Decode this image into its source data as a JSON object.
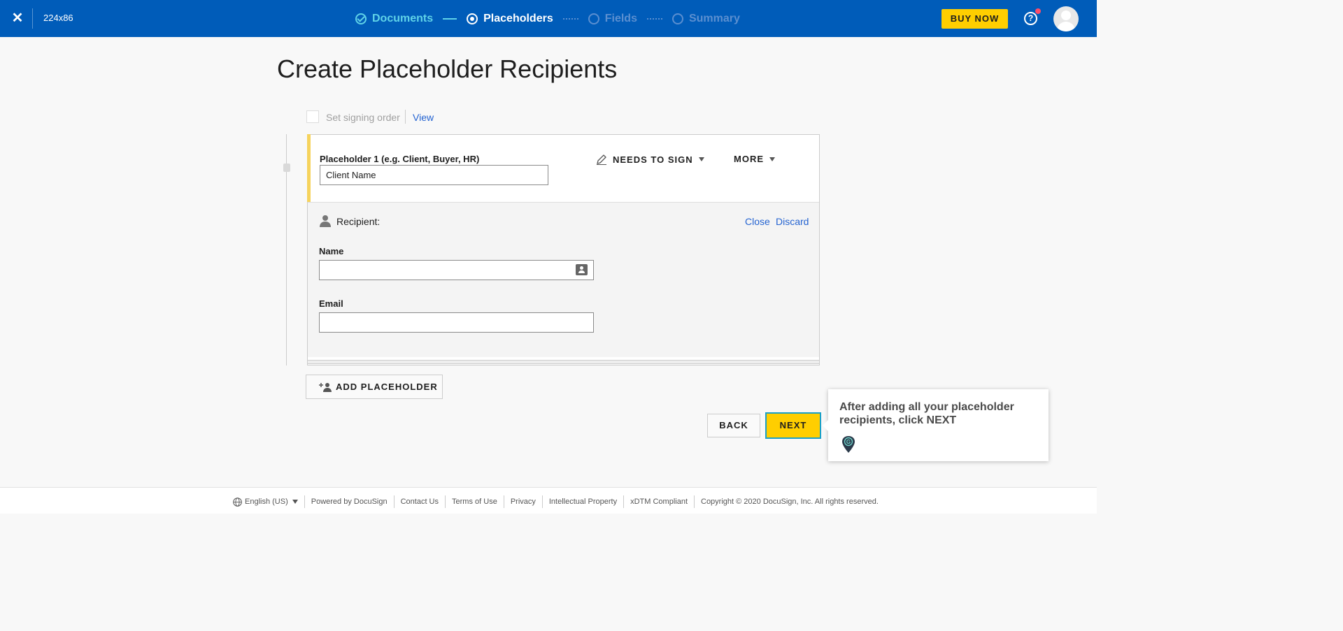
{
  "header": {
    "close_glyph": "✕",
    "document_title": "224x86",
    "steps": [
      {
        "label": "Documents",
        "state": "done"
      },
      {
        "label": "Placeholders",
        "state": "active"
      },
      {
        "label": "Fields",
        "state": "future"
      },
      {
        "label": "Summary",
        "state": "future"
      }
    ],
    "buy_now_label": "BUY NOW",
    "help_glyph": "?"
  },
  "page": {
    "title": "Create Placeholder Recipients",
    "signing_order_label": "Set signing order",
    "view_link": "View"
  },
  "placeholder": {
    "label": "Placeholder 1 (e.g. Client, Buyer, HR)",
    "value": "Client Name",
    "action_label": "NEEDS TO SIGN",
    "more_label": "MORE",
    "recipient": {
      "heading": "Recipient:",
      "close_label": "Close",
      "discard_label": "Discard",
      "name_label": "Name",
      "name_value": "",
      "email_label": "Email",
      "email_value": ""
    }
  },
  "actions": {
    "add_placeholder_label": "ADD PLACEHOLDER",
    "back_label": "BACK",
    "next_label": "NEXT"
  },
  "tooltip": {
    "text": "After adding all your placeholder recipients, click NEXT",
    "pin_letter": "G"
  },
  "footer": {
    "language": "English (US)",
    "links": [
      "Powered by DocuSign",
      "Contact Us",
      "Terms of Use",
      "Privacy",
      "Intellectual Property",
      "xDTM Compliant"
    ],
    "copyright": "Copyright © 2020 DocuSign, Inc. All rights reserved."
  },
  "colors": {
    "header_bg": "#005cb9",
    "accent_yellow": "#ffce00",
    "link_blue": "#2463d1",
    "step_done": "#5fd3e8",
    "placeholder_stripe": "#f6d35c"
  }
}
